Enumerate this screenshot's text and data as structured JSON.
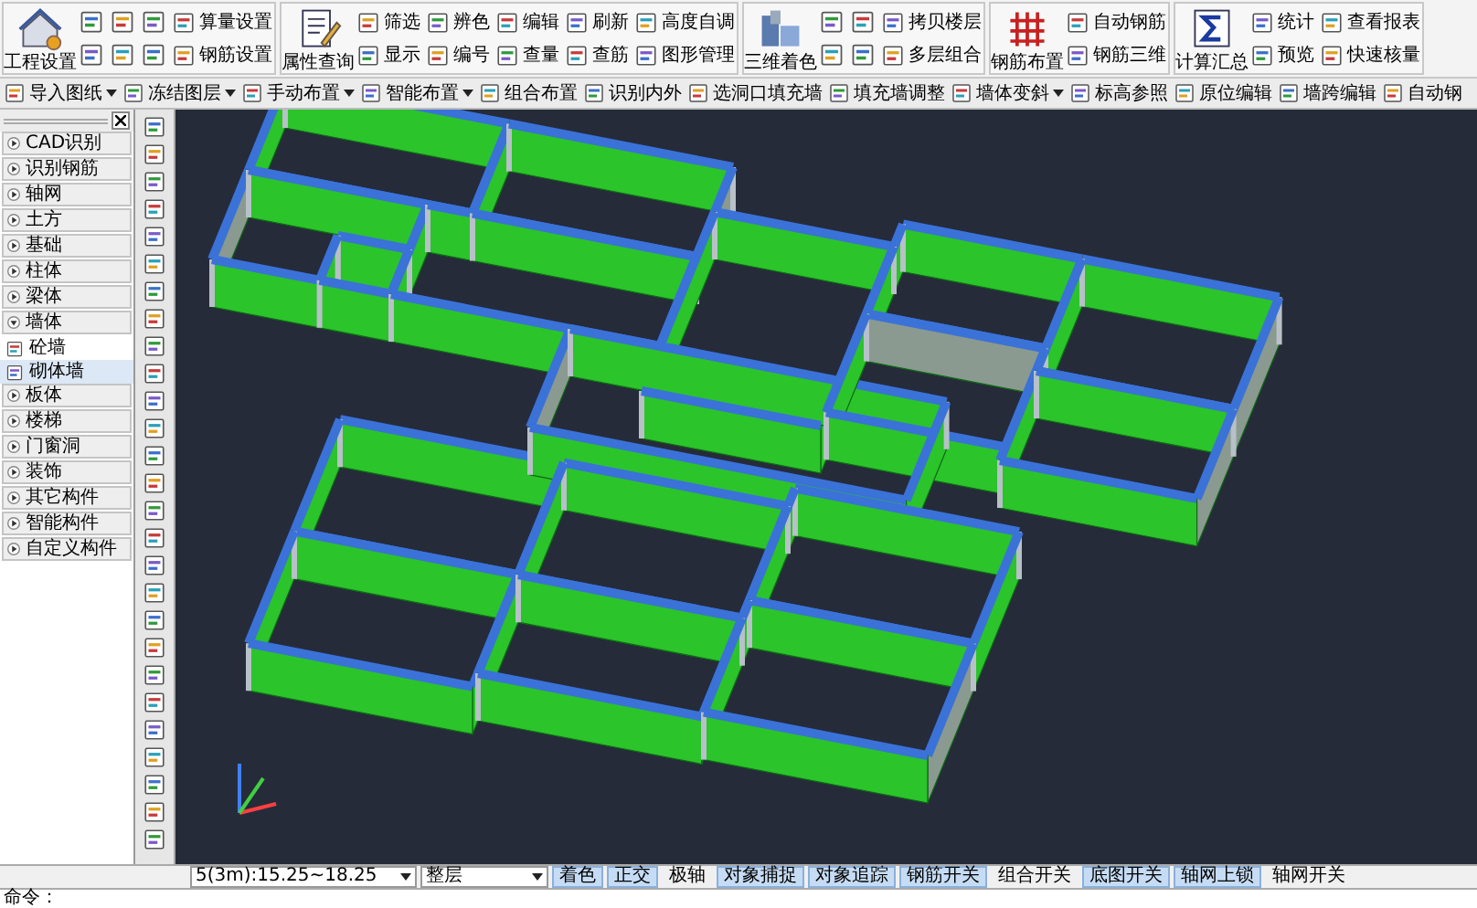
{
  "ribbon": [
    {
      "large": "工程设置",
      "small": [
        {
          "kind": "icon"
        },
        {
          "kind": "icon"
        },
        {
          "kind": "icon"
        },
        {
          "kind": "labeled",
          "label": "算量设置"
        },
        {
          "kind": "icon"
        },
        {
          "kind": "icon"
        },
        {
          "kind": "icon"
        },
        {
          "kind": "labeled",
          "label": "钢筋设置"
        }
      ]
    },
    {
      "large": "属性查询",
      "small": [
        {
          "kind": "labeled",
          "label": "筛选"
        },
        {
          "kind": "labeled",
          "label": "辨色"
        },
        {
          "kind": "labeled",
          "label": "编辑"
        },
        {
          "kind": "labeled",
          "label": "刷新"
        },
        {
          "kind": "labeled",
          "label": "高度自调"
        },
        {
          "kind": "labeled",
          "label": "显示"
        },
        {
          "kind": "labeled",
          "label": "编号"
        },
        {
          "kind": "labeled",
          "label": "查量"
        },
        {
          "kind": "labeled",
          "label": "查筋"
        },
        {
          "kind": "labeled",
          "label": "图形管理"
        }
      ]
    },
    {
      "large": "三维着色",
      "small": [
        {
          "kind": "icon"
        },
        {
          "kind": "icon"
        },
        {
          "kind": "labeled",
          "label": "拷贝楼层"
        },
        {
          "kind": "icon"
        },
        {
          "kind": "icon"
        },
        {
          "kind": "labeled",
          "label": "多层组合"
        }
      ]
    },
    {
      "large": "钢筋布置",
      "small": [
        {
          "kind": "labeled",
          "label": "自动钢筋"
        },
        {
          "kind": "labeled",
          "label": "钢筋三维"
        }
      ]
    },
    {
      "large": "计算汇总",
      "small": [
        {
          "kind": "labeled",
          "label": "统计"
        },
        {
          "kind": "labeled",
          "label": "查看报表"
        },
        {
          "kind": "labeled",
          "label": "预览"
        },
        {
          "kind": "labeled",
          "label": "快速核量"
        }
      ]
    }
  ],
  "toolbar": [
    {
      "label": "导入图纸",
      "dropdown": true
    },
    {
      "label": "冻结图层",
      "dropdown": true
    },
    {
      "label": "手动布置",
      "dropdown": true
    },
    {
      "label": "智能布置",
      "dropdown": true
    },
    {
      "label": "组合布置",
      "dropdown": false
    },
    {
      "label": "识别内外",
      "dropdown": false
    },
    {
      "label": "选洞口填充墙",
      "dropdown": false
    },
    {
      "label": "填充墙调整",
      "dropdown": false
    },
    {
      "label": "墙体变斜",
      "dropdown": true
    },
    {
      "label": "标高参照",
      "dropdown": false
    },
    {
      "label": "原位编辑",
      "dropdown": false
    },
    {
      "label": "墙跨编辑",
      "dropdown": false
    },
    {
      "label": "自动钢",
      "dropdown": false
    }
  ],
  "tree": [
    {
      "label": "CAD识别",
      "expanded": false
    },
    {
      "label": "识别钢筋",
      "expanded": false
    },
    {
      "label": "轴网",
      "expanded": false
    },
    {
      "label": "土方",
      "expanded": false
    },
    {
      "label": "基础",
      "expanded": false
    },
    {
      "label": "柱体",
      "expanded": false
    },
    {
      "label": "梁体",
      "expanded": false
    },
    {
      "label": "墙体",
      "expanded": true,
      "children": [
        {
          "label": "砼墙",
          "selected": false
        },
        {
          "label": "砌体墙",
          "selected": true
        }
      ]
    },
    {
      "label": "板体",
      "expanded": false
    },
    {
      "label": "楼梯",
      "expanded": false
    },
    {
      "label": "门窗洞",
      "expanded": false
    },
    {
      "label": "装饰",
      "expanded": false
    },
    {
      "label": "其它构件",
      "expanded": false
    },
    {
      "label": "智能构件",
      "expanded": false
    },
    {
      "label": "自定义构件",
      "expanded": false
    }
  ],
  "status_bar": {
    "floor": "5(3m):15.25~18.25",
    "scope": "整层",
    "toggles": [
      {
        "label": "着色",
        "on": true
      },
      {
        "label": "正交",
        "on": true
      },
      {
        "label": "极轴",
        "on": false
      },
      {
        "label": "对象捕捉",
        "on": true
      },
      {
        "label": "对象追踪",
        "on": true
      },
      {
        "label": "钢筋开关",
        "on": true
      },
      {
        "label": "组合开关",
        "on": false
      },
      {
        "label": "底图开关",
        "on": true
      },
      {
        "label": "轴网上锁",
        "on": true
      },
      {
        "label": "轴网开关",
        "on": false
      }
    ]
  },
  "command_line": "命令："
}
